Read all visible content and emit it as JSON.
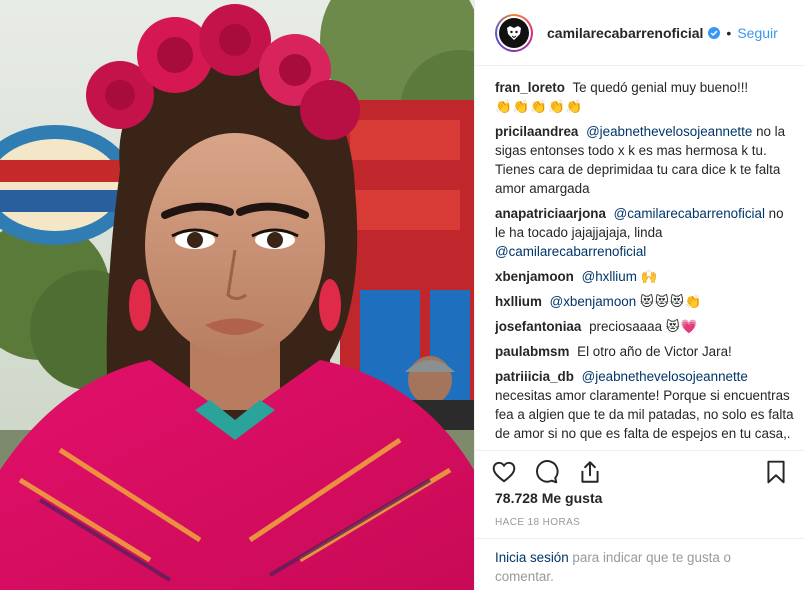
{
  "post": {
    "username": "camilarecabarrenoficial",
    "follow_label": "Seguir",
    "dot": "•"
  },
  "comments": [
    {
      "user": "fran_loreto",
      "text": "Te quedó genial muy bueno!!!",
      "emoji": "👏👏👏👏👏"
    },
    {
      "user": "pricilaandrea",
      "mention": "@jeabnethevelosojeannette",
      "text": "no la sigas entonses todo x k es mas hermosa k tu. Tienes cara de deprimidaa tu cara dice k te falta amor amargada"
    },
    {
      "user": "anapatriciaarjona",
      "mention": "@camilarecabarrenoficial",
      "text": "no le ha tocado jajajjajaja, linda",
      "mention2": "@camilarecabarrenoficial"
    },
    {
      "user": "xbenjamoon",
      "mention": "@hxllium",
      "emoji": "🙌"
    },
    {
      "user": "hxllium",
      "mention": "@xbenjamoon",
      "emoji": "😻😻😻👏"
    },
    {
      "user": "josefantoniaa",
      "text": "preciosaaaa",
      "emoji": "😻💗"
    },
    {
      "user": "paulabmsm",
      "text": "El otro año de Victor Jara!"
    },
    {
      "user": "patriiicia_db",
      "mention": "@jeabnethevelosojeannette",
      "text": "necesitas amor claramente! Porque si encuentras fea a algien que te da mil patadas, no solo es falta de amor si no que es falta de espejos en tu casa,."
    }
  ],
  "stats": {
    "likes": "78.728 Me gusta",
    "time": "HACE 18 HORAS"
  },
  "login": {
    "link": "Inicia sesión",
    "rest": " para indicar que te gusta o comentar."
  },
  "icons": {
    "like": "heart-icon",
    "comment": "comment-icon",
    "share": "share-icon",
    "save": "bookmark-icon",
    "verified": "verified-badge-icon"
  },
  "colors": {
    "link_blue": "#3897f0",
    "mention_blue": "#003569",
    "text": "#262626",
    "muted": "#999999"
  }
}
